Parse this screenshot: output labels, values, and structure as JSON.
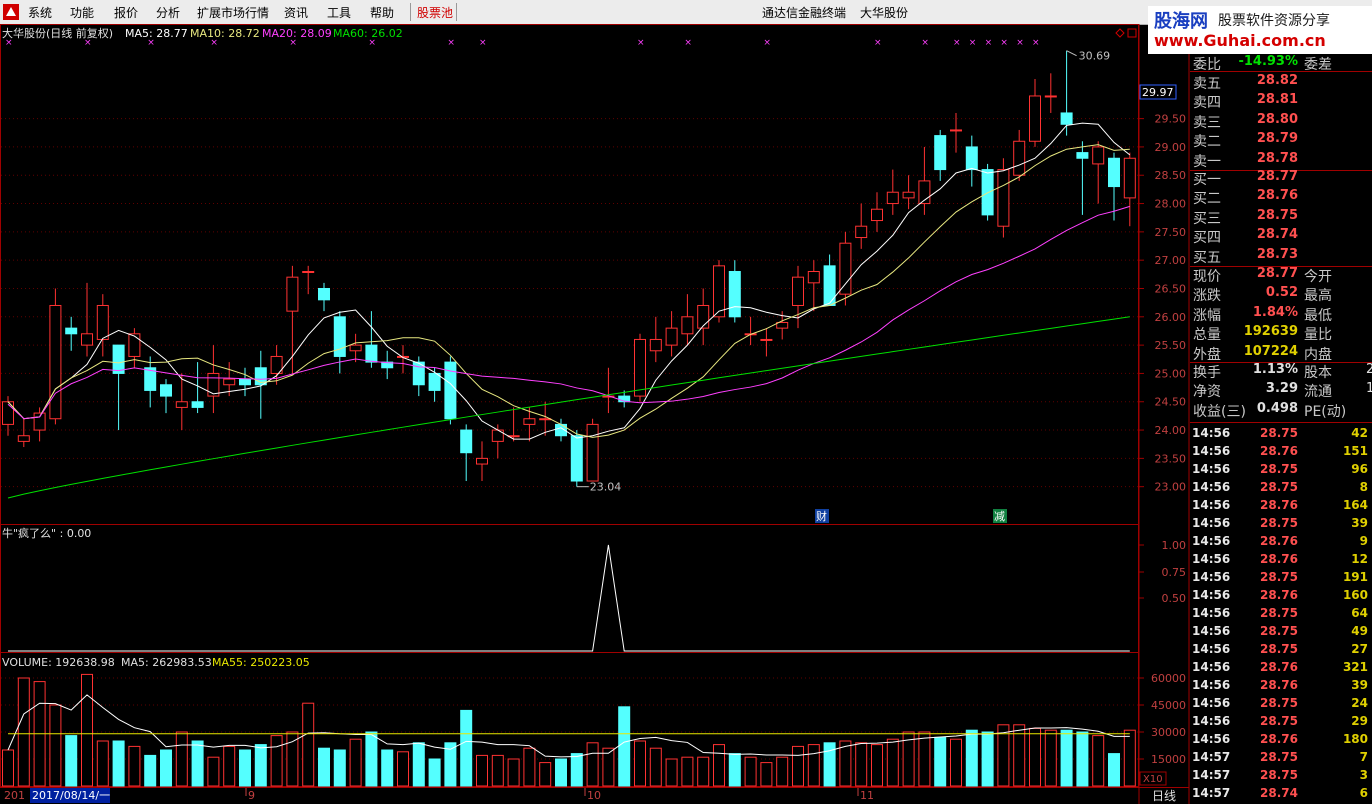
{
  "menu": {
    "items": [
      "系统",
      "功能",
      "报价",
      "分析",
      "扩展市场行情",
      "资讯",
      "工具",
      "帮助",
      "股票池"
    ],
    "terminal_title": "通达信金融终端",
    "stock_title": "大华股份"
  },
  "watermark": {
    "brand": "股海网",
    "slogan": "股票软件资源分享",
    "url": "www.Guhai.com.cn"
  },
  "colors": {
    "up": "#ff3232",
    "down": "#54ffff",
    "ma5": "#ffffff",
    "ma10": "#e8e880",
    "ma20": "#ff40ff",
    "ma60": "#00e000",
    "volma5": "#ffffff",
    "volma55": "#e8e800"
  },
  "main_chart": {
    "header_name": "大华股份(日线 前复权)",
    "ma5_label": "MA5: 28.77",
    "ma10_label": "MA10: 28.72",
    "ma20_label": "MA20: 28.09",
    "ma60_label": "MA60: 26.02",
    "price_axis": [
      "29.50",
      "29.00",
      "28.50",
      "28.00",
      "27.50",
      "27.00",
      "26.50",
      "26.00",
      "25.50",
      "25.00",
      "24.50",
      "24.00",
      "23.50",
      "23.00"
    ],
    "current_price_tag": "29.97",
    "high_label": "30.69",
    "low_label": "23.04",
    "event_labels": [
      "财",
      "减"
    ]
  },
  "indicator": {
    "header": "牛\"疯了么\" : 0.00",
    "axis": [
      "1.00",
      "0.75",
      "0.50"
    ]
  },
  "volume": {
    "header_vol": "VOLUME: 192638.98",
    "header_ma5": "MA5: 262983.53",
    "header_ma55": "MA55: 250223.05",
    "axis": [
      "60000",
      "45000",
      "30000",
      "15000"
    ],
    "unit": "X10"
  },
  "date_axis": {
    "start": "201",
    "selected": "2017/08/14/一",
    "months": [
      "9",
      "10",
      "11"
    ],
    "period": "日线"
  },
  "chart_data": {
    "type": "candlestick",
    "ylim": [
      22.5,
      30.8
    ],
    "candles": [
      [
        24.1,
        24.5,
        24.6,
        23.9
      ],
      [
        23.8,
        23.9,
        24.2,
        23.7
      ],
      [
        24.0,
        24.3,
        24.4,
        23.8
      ],
      [
        24.2,
        26.2,
        26.5,
        24.1
      ],
      [
        25.8,
        25.7,
        26.0,
        25.4
      ],
      [
        25.5,
        25.7,
        26.6,
        25.3
      ],
      [
        25.6,
        26.2,
        26.4,
        25.3
      ],
      [
        25.5,
        25.0,
        25.5,
        24.0
      ],
      [
        25.3,
        25.7,
        25.8,
        25.1
      ],
      [
        25.1,
        24.7,
        25.3,
        24.4
      ],
      [
        24.8,
        24.6,
        24.9,
        24.3
      ],
      [
        24.4,
        24.5,
        25.0,
        24.0
      ],
      [
        24.5,
        24.4,
        25.2,
        24.3
      ],
      [
        24.6,
        25.0,
        25.5,
        24.3
      ],
      [
        24.8,
        24.9,
        25.2,
        24.6
      ],
      [
        24.9,
        24.8,
        25.1,
        24.6
      ],
      [
        25.1,
        24.8,
        25.4,
        24.2
      ],
      [
        25.0,
        25.3,
        25.5,
        24.8
      ],
      [
        26.1,
        26.7,
        26.9,
        25.0
      ],
      [
        26.8,
        26.8,
        26.9,
        26.4
      ],
      [
        26.5,
        26.3,
        26.6,
        26.1
      ],
      [
        26.0,
        25.3,
        26.1,
        25.0
      ],
      [
        25.4,
        25.5,
        25.7,
        25.2
      ],
      [
        25.5,
        25.2,
        26.1,
        25.1
      ],
      [
        25.2,
        25.1,
        25.4,
        24.9
      ],
      [
        25.3,
        25.3,
        25.5,
        25.0
      ],
      [
        25.2,
        24.8,
        25.3,
        24.6
      ],
      [
        25.0,
        24.7,
        25.1,
        24.5
      ],
      [
        25.2,
        24.2,
        25.3,
        24.1
      ],
      [
        24.0,
        23.6,
        24.1,
        23.1
      ],
      [
        23.4,
        23.5,
        23.8,
        23.1
      ],
      [
        23.8,
        24.0,
        24.1,
        23.5
      ],
      [
        23.9,
        23.9,
        24.4,
        23.8
      ],
      [
        24.1,
        24.2,
        24.4,
        23.8
      ],
      [
        24.2,
        24.2,
        24.5,
        23.9
      ],
      [
        24.1,
        23.9,
        24.2,
        23.8
      ],
      [
        23.9,
        23.1,
        24.0,
        23.0
      ],
      [
        23.1,
        24.1,
        24.2,
        23.1
      ],
      [
        24.6,
        24.6,
        25.1,
        24.3
      ],
      [
        24.6,
        24.5,
        24.7,
        24.4
      ],
      [
        24.6,
        25.6,
        25.7,
        24.5
      ],
      [
        25.4,
        25.6,
        26.0,
        25.2
      ],
      [
        25.5,
        25.8,
        26.1,
        25.3
      ],
      [
        25.7,
        26.0,
        26.4,
        25.5
      ],
      [
        25.8,
        26.2,
        26.5,
        25.5
      ],
      [
        26.0,
        26.9,
        27.0,
        25.9
      ],
      [
        26.8,
        26.0,
        27.0,
        25.9
      ],
      [
        25.7,
        25.7,
        26.0,
        25.5
      ],
      [
        25.6,
        25.6,
        25.8,
        25.3
      ],
      [
        25.8,
        25.9,
        26.1,
        25.6
      ],
      [
        26.2,
        26.7,
        26.9,
        25.8
      ],
      [
        26.6,
        26.8,
        27.0,
        26.1
      ],
      [
        26.9,
        26.2,
        27.1,
        26.2
      ],
      [
        26.4,
        27.3,
        27.5,
        26.2
      ],
      [
        27.4,
        27.6,
        28.0,
        27.2
      ],
      [
        27.7,
        27.9,
        28.2,
        27.5
      ],
      [
        28.0,
        28.2,
        28.6,
        27.8
      ],
      [
        28.1,
        28.2,
        28.5,
        27.9
      ],
      [
        28.0,
        28.4,
        29.0,
        27.8
      ],
      [
        29.2,
        28.6,
        29.3,
        28.4
      ],
      [
        29.3,
        29.3,
        29.6,
        28.9
      ],
      [
        29.0,
        28.6,
        29.2,
        28.3
      ],
      [
        28.6,
        27.8,
        28.7,
        27.7
      ],
      [
        27.6,
        28.6,
        28.8,
        27.4
      ],
      [
        28.5,
        29.1,
        29.3,
        28.4
      ],
      [
        29.1,
        29.9,
        30.2,
        29.0
      ],
      [
        29.9,
        29.9,
        30.3,
        29.6
      ],
      [
        29.6,
        29.4,
        30.7,
        29.2
      ],
      [
        28.9,
        28.8,
        29.1,
        27.8
      ],
      [
        28.7,
        29.0,
        29.1,
        28.0
      ],
      [
        28.8,
        28.3,
        28.9,
        27.7
      ],
      [
        28.1,
        28.8,
        28.9,
        27.6
      ]
    ],
    "volume": [
      20000,
      60000,
      58000,
      45000,
      28000,
      62000,
      25000,
      25000,
      22000,
      17000,
      20000,
      30000,
      25000,
      16000,
      22000,
      20000,
      23000,
      28000,
      30000,
      46000,
      21000,
      20000,
      26000,
      30000,
      20000,
      19000,
      24000,
      15000,
      24000,
      42000,
      17000,
      17000,
      15000,
      21000,
      13000,
      15000,
      18000,
      24000,
      21000,
      44000,
      25000,
      21000,
      15000,
      16000,
      16000,
      23000,
      18000,
      16000,
      13000,
      16000,
      22000,
      23000,
      24000,
      25000,
      24000,
      23000,
      26000,
      30000,
      30000,
      27000,
      26000,
      31000,
      30000,
      34000,
      34000,
      32000,
      31000,
      31000,
      30000,
      28000,
      18000,
      31000
    ],
    "indicator_values": {
      "spike_index": 38,
      "spike_value": 1.0,
      "baseline": 0.0
    }
  },
  "right_panel": {
    "weibi": {
      "label": "委比",
      "value": "-14.93%",
      "right": "委差"
    },
    "sells": [
      {
        "label": "卖五",
        "price": "28.82"
      },
      {
        "label": "卖四",
        "price": "28.81"
      },
      {
        "label": "卖三",
        "price": "28.80"
      },
      {
        "label": "卖二",
        "price": "28.79"
      },
      {
        "label": "卖一",
        "price": "28.78"
      }
    ],
    "buys": [
      {
        "label": "买一",
        "price": "28.77"
      },
      {
        "label": "买二",
        "price": "28.76"
      },
      {
        "label": "买三",
        "price": "28.75"
      },
      {
        "label": "买四",
        "price": "28.74"
      },
      {
        "label": "买五",
        "price": "28.73"
      }
    ],
    "quote": [
      {
        "label": "现价",
        "value": "28.77",
        "right": "今开"
      },
      {
        "label": "涨跌",
        "value": "0.52",
        "right": "最高"
      },
      {
        "label": "涨幅",
        "value": "1.84%",
        "right": "最低"
      },
      {
        "label": "总量",
        "value": "192639",
        "right": "量比"
      },
      {
        "label": "外盘",
        "value": "107224",
        "right": "内盘"
      }
    ],
    "stats": [
      {
        "label": "换手",
        "value": "1.13%",
        "right": "股本"
      },
      {
        "label": "净资",
        "value": "3.29",
        "right": "流通"
      },
      {
        "label": "收益(三)",
        "value": "0.498",
        "right": "PE(动)"
      }
    ],
    "stats_right_values": [
      "2",
      "1"
    ],
    "ticks": [
      {
        "time": "14:56",
        "price": "28.75",
        "vol": "42"
      },
      {
        "time": "14:56",
        "price": "28.76",
        "vol": "151"
      },
      {
        "time": "14:56",
        "price": "28.75",
        "vol": "96"
      },
      {
        "time": "14:56",
        "price": "28.75",
        "vol": "8"
      },
      {
        "time": "14:56",
        "price": "28.76",
        "vol": "164"
      },
      {
        "time": "14:56",
        "price": "28.75",
        "vol": "39"
      },
      {
        "time": "14:56",
        "price": "28.76",
        "vol": "9"
      },
      {
        "time": "14:56",
        "price": "28.76",
        "vol": "12"
      },
      {
        "time": "14:56",
        "price": "28.75",
        "vol": "191"
      },
      {
        "time": "14:56",
        "price": "28.76",
        "vol": "160"
      },
      {
        "time": "14:56",
        "price": "28.75",
        "vol": "64"
      },
      {
        "time": "14:56",
        "price": "28.75",
        "vol": "49"
      },
      {
        "time": "14:56",
        "price": "28.75",
        "vol": "27"
      },
      {
        "time": "14:56",
        "price": "28.76",
        "vol": "321"
      },
      {
        "time": "14:56",
        "price": "28.76",
        "vol": "39"
      },
      {
        "time": "14:56",
        "price": "28.75",
        "vol": "24"
      },
      {
        "time": "14:56",
        "price": "28.75",
        "vol": "29"
      },
      {
        "time": "14:56",
        "price": "28.76",
        "vol": "180"
      },
      {
        "time": "14:57",
        "price": "28.75",
        "vol": "7"
      },
      {
        "time": "14:57",
        "price": "28.75",
        "vol": "3"
      },
      {
        "time": "14:57",
        "price": "28.74",
        "vol": "6"
      }
    ]
  }
}
